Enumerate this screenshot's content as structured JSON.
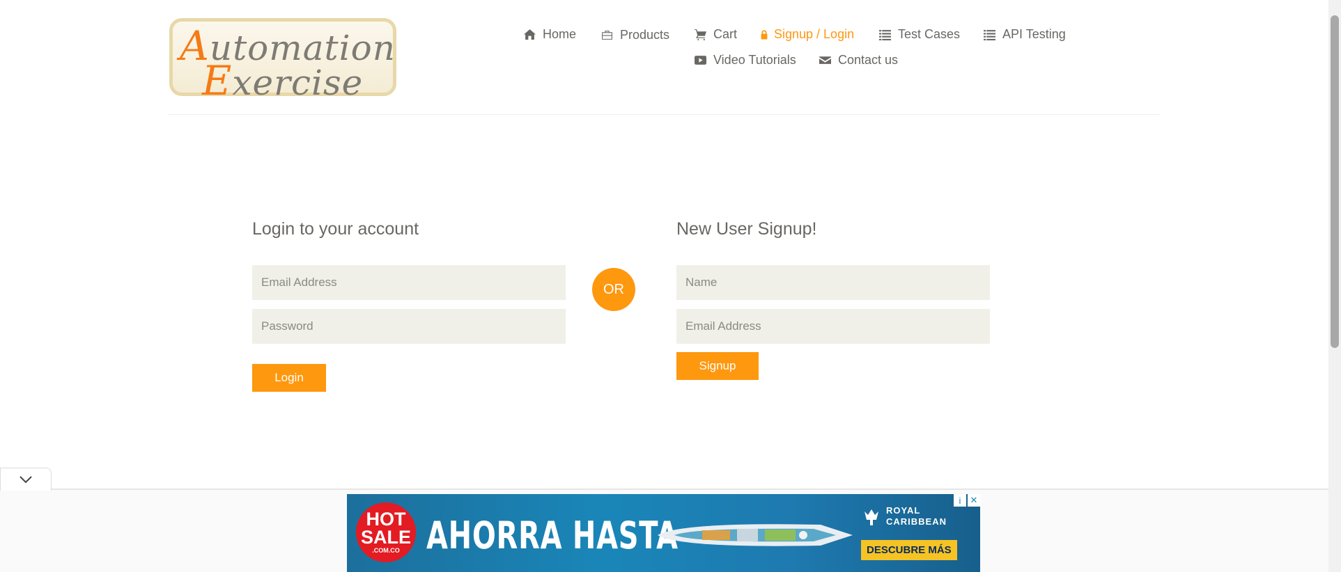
{
  "logo": {
    "line1_cap": "A",
    "line1_rest": "utomation",
    "line2_cap": "E",
    "line2_rest": "xercise"
  },
  "nav": {
    "home": "Home",
    "products": "Products",
    "cart": "Cart",
    "signup_login": "Signup / Login",
    "test_cases": "Test Cases",
    "api_testing": "API Testing",
    "video_tutorials": "Video Tutorials",
    "contact_us": "Contact us"
  },
  "login": {
    "title": "Login to your account",
    "email_placeholder": "Email Address",
    "password_placeholder": "Password",
    "button": "Login"
  },
  "or_label": "OR",
  "signup": {
    "title": "New User Signup!",
    "name_placeholder": "Name",
    "email_placeholder": "Email Address",
    "button": "Signup"
  },
  "ad": {
    "hot": "HOT",
    "sale": "SALE",
    "domain": ".COM.CO",
    "headline": "AHORRA HASTA",
    "brand_line1": "ROYAL",
    "brand_line2": "CARIBBEAN",
    "cta": "DESCUBRE MÁS",
    "info_icon": "i",
    "close_icon": "✕"
  },
  "colors": {
    "accent": "#FE980F",
    "text": "#696763",
    "input_bg": "#F0F0E9"
  }
}
